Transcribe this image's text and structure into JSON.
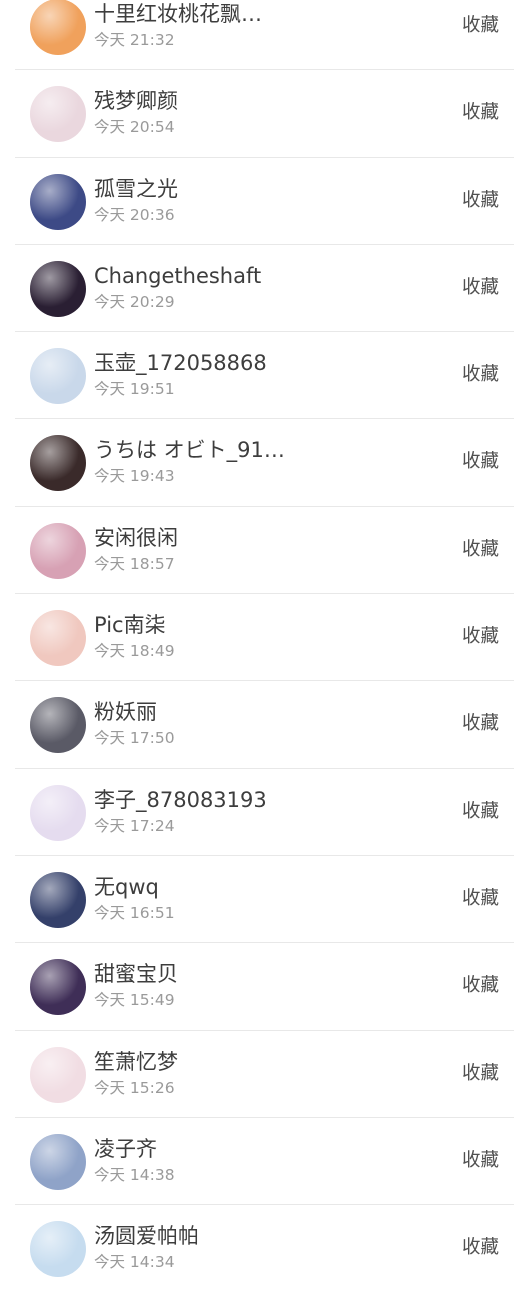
{
  "favorite_label": "收藏",
  "users": [
    {
      "name": "十里红妆桃花飘…",
      "time": "今天 21:32",
      "avatar_icon": "white-bunny-avatar-icon",
      "avatar_color": "#f0a15c"
    },
    {
      "name": "残梦卿颜",
      "time": "今天 20:54",
      "avatar_icon": "anime-girl-pink-avatar-icon",
      "avatar_color": "#ead7de"
    },
    {
      "name": "孤雪之光",
      "time": "今天 20:36",
      "avatar_icon": "blue-snow-anime-avatar-icon",
      "avatar_color": "#3d4a86"
    },
    {
      "name": "Changetheshaft",
      "time": "今天 20:29",
      "avatar_icon": "dark-anime-avatar-icon",
      "avatar_color": "#2a1f33"
    },
    {
      "name": "玉壶_172058868",
      "time": "今天 19:51",
      "avatar_icon": "pastel-anime-avatar-icon",
      "avatar_color": "#c9d8ea"
    },
    {
      "name": "うちは オビト_91…",
      "time": "今天 19:43",
      "avatar_icon": "masked-character-avatar-icon",
      "avatar_color": "#3a2a2a"
    },
    {
      "name": "安闲很闲",
      "time": "今天 18:57",
      "avatar_icon": "pink-hair-anime-avatar-icon",
      "avatar_color": "#d7a1b4"
    },
    {
      "name": "Pic南柒",
      "time": "今天 18:49",
      "avatar_icon": "peach-anime-avatar-icon",
      "avatar_color": "#f0c8bf"
    },
    {
      "name": "粉妖丽",
      "time": "今天 17:50",
      "avatar_icon": "skeleton-character-avatar-icon",
      "avatar_color": "#5a5a66"
    },
    {
      "name": "李子_878083193",
      "time": "今天 17:24",
      "avatar_icon": "white-hair-anime-avatar-icon",
      "avatar_color": "#e5dcef"
    },
    {
      "name": "无qwq",
      "time": "今天 16:51",
      "avatar_icon": "night-sky-character-avatar-icon",
      "avatar_color": "#34406a"
    },
    {
      "name": "甜蜜宝贝",
      "time": "今天 15:49",
      "avatar_icon": "purple-anime-avatar-icon",
      "avatar_color": "#3f2e57"
    },
    {
      "name": "笙萧忆梦",
      "time": "今天 15:26",
      "avatar_icon": "pale-anime-avatar-icon",
      "avatar_color": "#f1dde3"
    },
    {
      "name": "凌子齐",
      "time": "今天 14:38",
      "avatar_icon": "blue-art-anime-avatar-icon",
      "avatar_color": "#8fa3c8"
    },
    {
      "name": "汤圆爱帕帕",
      "time": "今天 14:34",
      "avatar_icon": "light-blue-anime-avatar-icon",
      "avatar_color": "#c6dcef"
    }
  ]
}
